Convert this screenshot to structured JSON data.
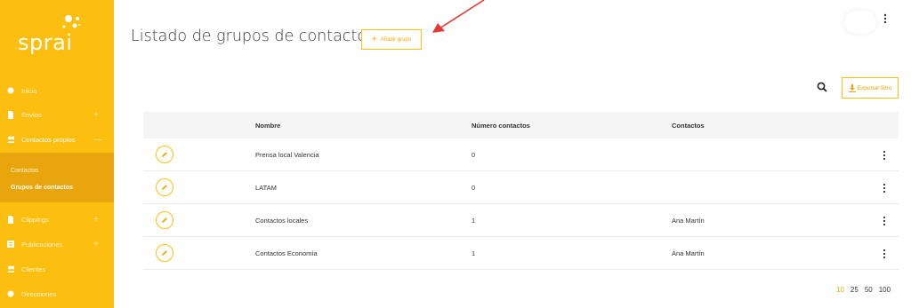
{
  "brand": {
    "name": "sprai"
  },
  "header": {
    "title": "Listado de grupos de contactos",
    "add_label": "Añadir grupo"
  },
  "toolbar": {
    "export_label": "Exportar filtro"
  },
  "sidebar": {
    "items": [
      {
        "label": "Inicio",
        "icon": "dot-icon",
        "sign": ""
      },
      {
        "label": "Envíos",
        "icon": "file-icon",
        "sign": "+"
      },
      {
        "label": "Contactos propios",
        "icon": "people-icon",
        "sign": "—"
      },
      {
        "label": "Clippings",
        "icon": "file-icon",
        "sign": "+"
      },
      {
        "label": "Publicaciones",
        "icon": "doc-icon",
        "sign": "+"
      },
      {
        "label": "Clientes",
        "icon": "people-icon",
        "sign": ""
      },
      {
        "label": "Direcciones",
        "icon": "dot-icon",
        "sign": ""
      }
    ],
    "submenu": [
      {
        "label": "Contactos"
      },
      {
        "label": "Grupos de contactos"
      }
    ]
  },
  "table": {
    "columns": [
      "Nombre",
      "Número contactos",
      "Contactos"
    ],
    "rows": [
      {
        "name": "Prensa local Valencia",
        "count": "0",
        "contacts": ""
      },
      {
        "name": "LATAM",
        "count": "0",
        "contacts": ""
      },
      {
        "name": "Contactos locales",
        "count": "1",
        "contacts": "Ana Martín"
      },
      {
        "name": "Contactos Economía",
        "count": "1",
        "contacts": "Ana Martín"
      }
    ]
  },
  "pagination": {
    "options": [
      "10",
      "25",
      "50",
      "100"
    ],
    "selected": "10"
  },
  "colors": {
    "brand": "#fdbf0f",
    "submenu": "#e9a60c",
    "accent_text": "#f0a500",
    "arrow": "#e53935"
  }
}
